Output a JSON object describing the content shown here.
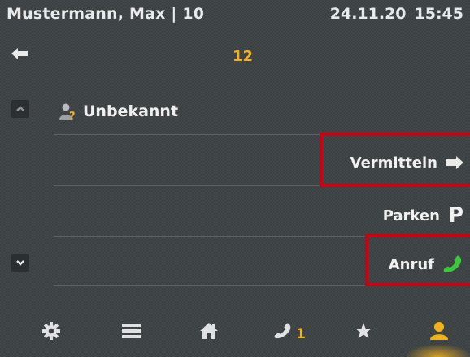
{
  "header": {
    "user": "Mustermann, Max | 10",
    "date": "24.11.20",
    "time": "15:45"
  },
  "call": {
    "number": "12",
    "caller": "Unbekannt"
  },
  "actions": {
    "transfer": "Vermitteln",
    "park": "Parken",
    "park_symbol": "P",
    "call": "Anruf"
  },
  "tabs": {
    "calls_count": "1"
  },
  "colors": {
    "accent": "#f2b21c",
    "highlight": "#cc0010",
    "call_green": "#3cc83c"
  },
  "icons": [
    "back-arrow-icon",
    "chevron-up-icon",
    "unknown-contact-icon",
    "arrow-right-icon",
    "phone-green-icon",
    "chevron-down-icon",
    "gear-icon",
    "menu-icon",
    "home-icon",
    "phone-icon",
    "star-icon",
    "person-icon"
  ]
}
